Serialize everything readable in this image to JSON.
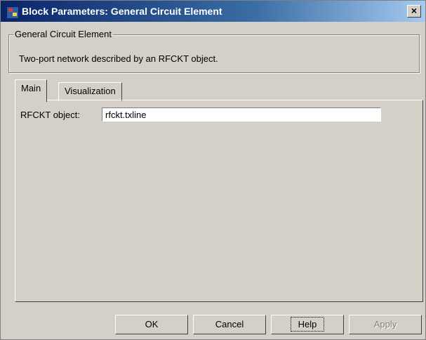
{
  "window": {
    "title": "Block Parameters: General  Circuit Element",
    "close_glyph": "×"
  },
  "group": {
    "legend": "General Circuit Element",
    "description": "Two-port network described by an RFCKT object."
  },
  "tabs": [
    {
      "label": "Main",
      "active": true
    },
    {
      "label": "Visualization",
      "active": false
    }
  ],
  "main": {
    "rfckt_label": "RFCKT object:",
    "rfckt_value": "rfckt.txline"
  },
  "buttons": {
    "ok": "OK",
    "cancel": "Cancel",
    "help": "Help",
    "apply": "Apply"
  }
}
